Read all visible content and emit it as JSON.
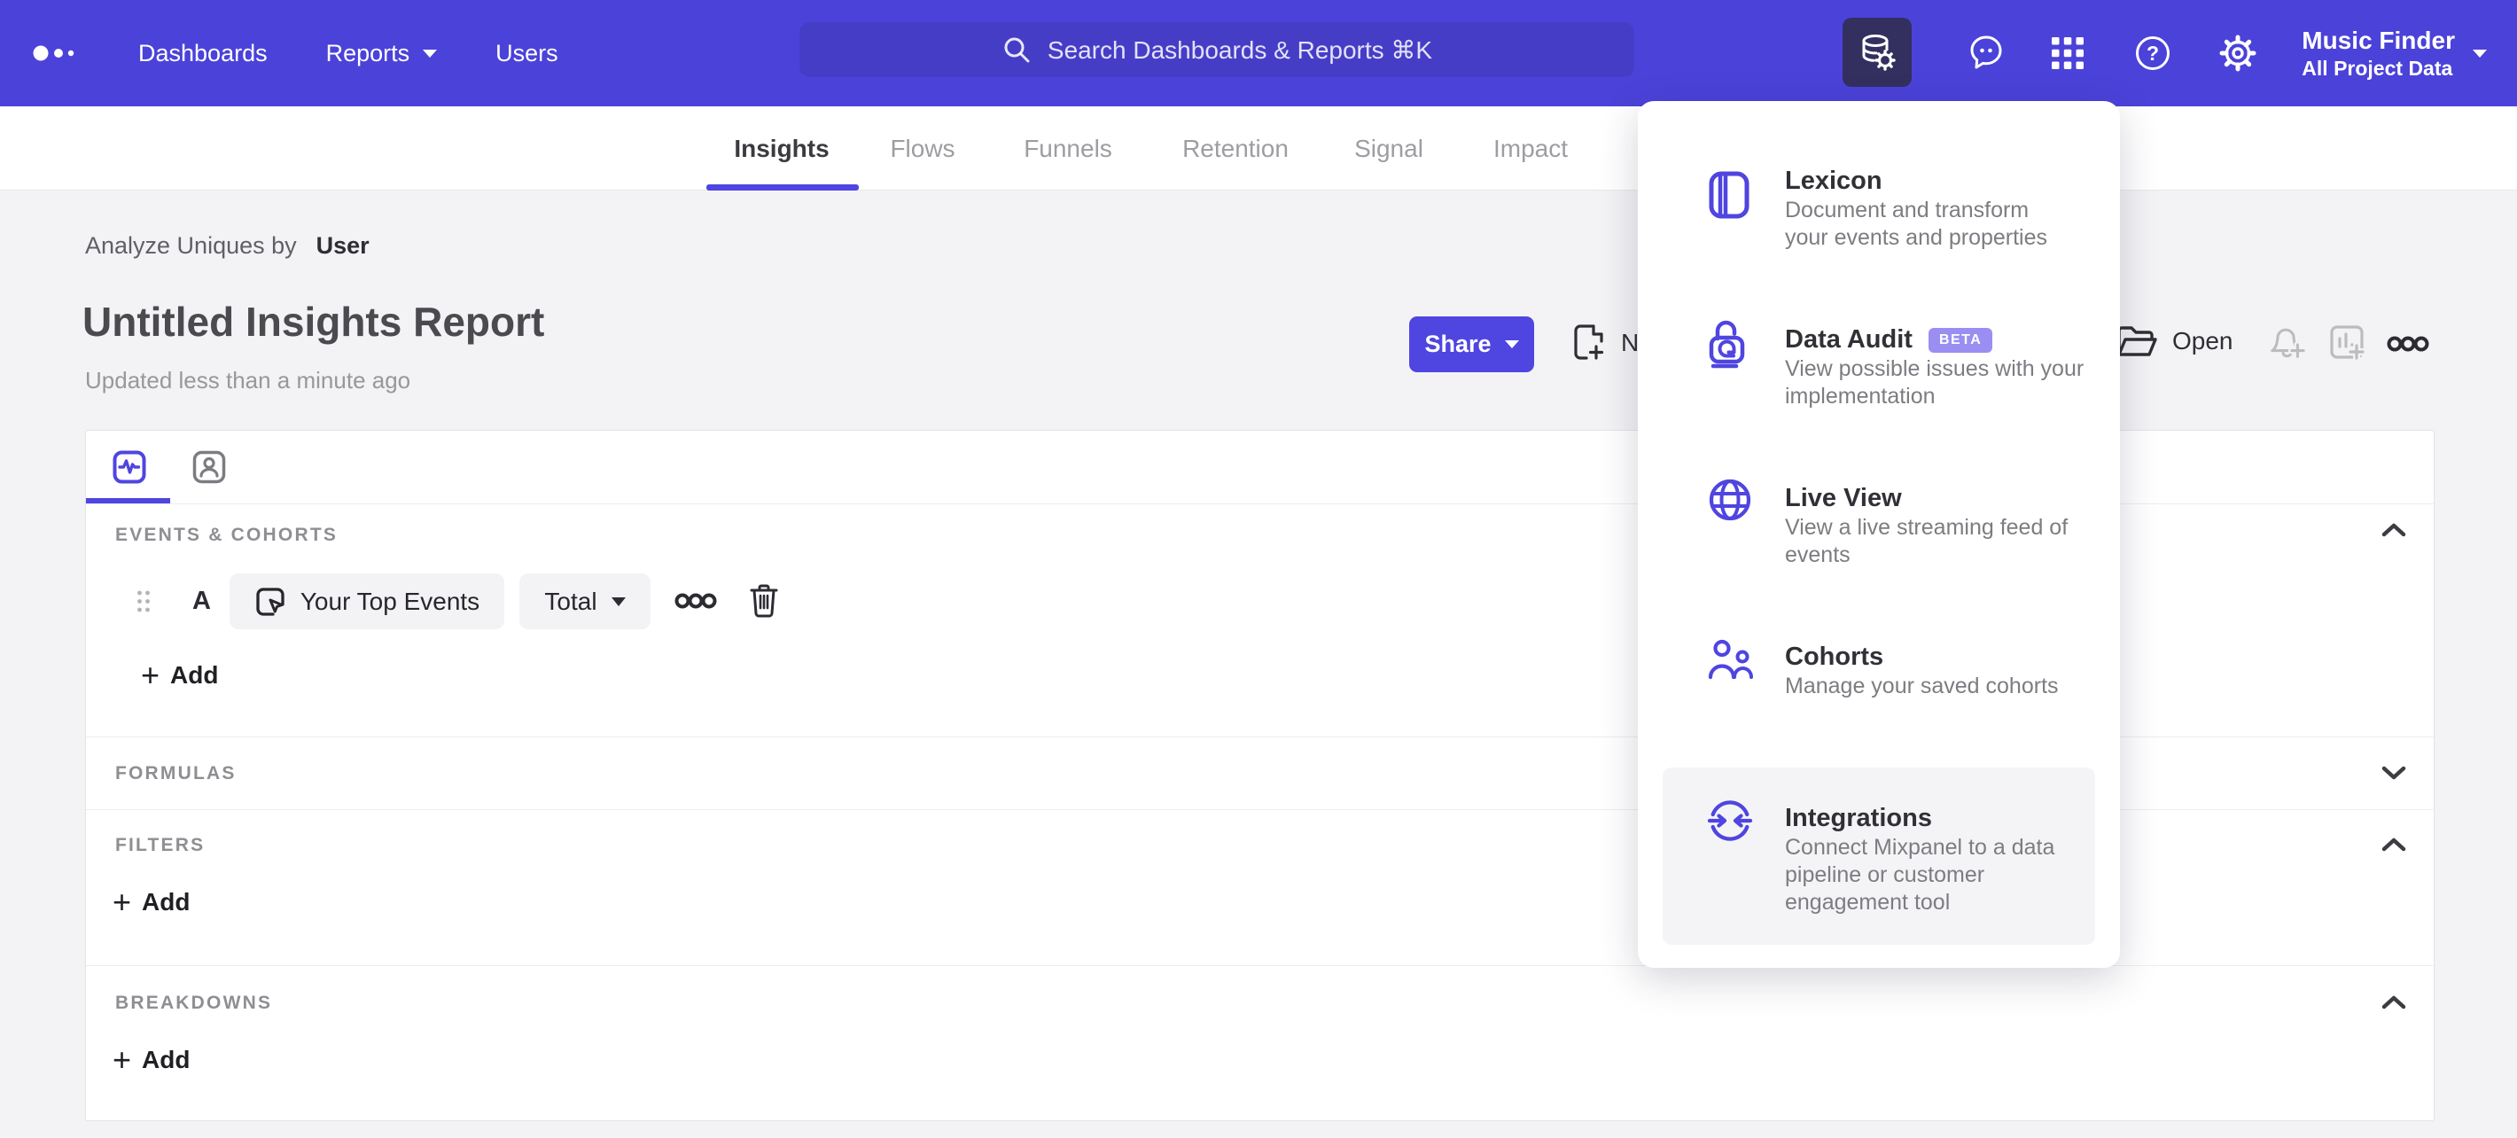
{
  "colors": {
    "nav": "#4b42d9",
    "accent": "#4f45e0",
    "badge": "#9a8ef2",
    "page_bg": "#f3f3f5"
  },
  "nav": {
    "items": [
      {
        "label": "Dashboards"
      },
      {
        "label": "Reports"
      },
      {
        "label": "Users"
      }
    ],
    "search_placeholder": "Search Dashboards & Reports ⌘K",
    "project": {
      "name": "Music Finder",
      "scope": "All Project Data"
    }
  },
  "tabs": [
    {
      "label": "Insights"
    },
    {
      "label": "Flows"
    },
    {
      "label": "Funnels"
    },
    {
      "label": "Retention"
    },
    {
      "label": "Signal"
    },
    {
      "label": "Impact"
    }
  ],
  "report": {
    "analyze_label": "Analyze Uniques by",
    "analyze_value": "User",
    "title": "Untitled Insights Report",
    "updated": "Updated less than a minute ago"
  },
  "toolbar": {
    "share_label": "Share",
    "new_label": "New",
    "open_label": "Open"
  },
  "builder": {
    "events_header": "EVENTS & COHORTS",
    "formulas_header": "FORMULAS",
    "filters_header": "FILTERS",
    "breakdowns_header": "BREAKDOWNS",
    "row": {
      "letter": "A",
      "event": "Your Top Events",
      "metric": "Total"
    },
    "plus": "+",
    "add_label": "Add"
  },
  "menu": {
    "items": [
      {
        "title": "Lexicon",
        "description": "Document and transform\nyour events and properties"
      },
      {
        "title": "Data Audit",
        "badge": "BETA",
        "description": "View possible issues with your\nimplementation"
      },
      {
        "title": "Live View",
        "description": "View a live streaming feed of\nevents"
      },
      {
        "title": "Cohorts",
        "description": "Manage your saved cohorts"
      },
      {
        "title": "Integrations",
        "description": "Connect Mixpanel to a data\npipeline or customer\nengagement tool"
      }
    ]
  }
}
